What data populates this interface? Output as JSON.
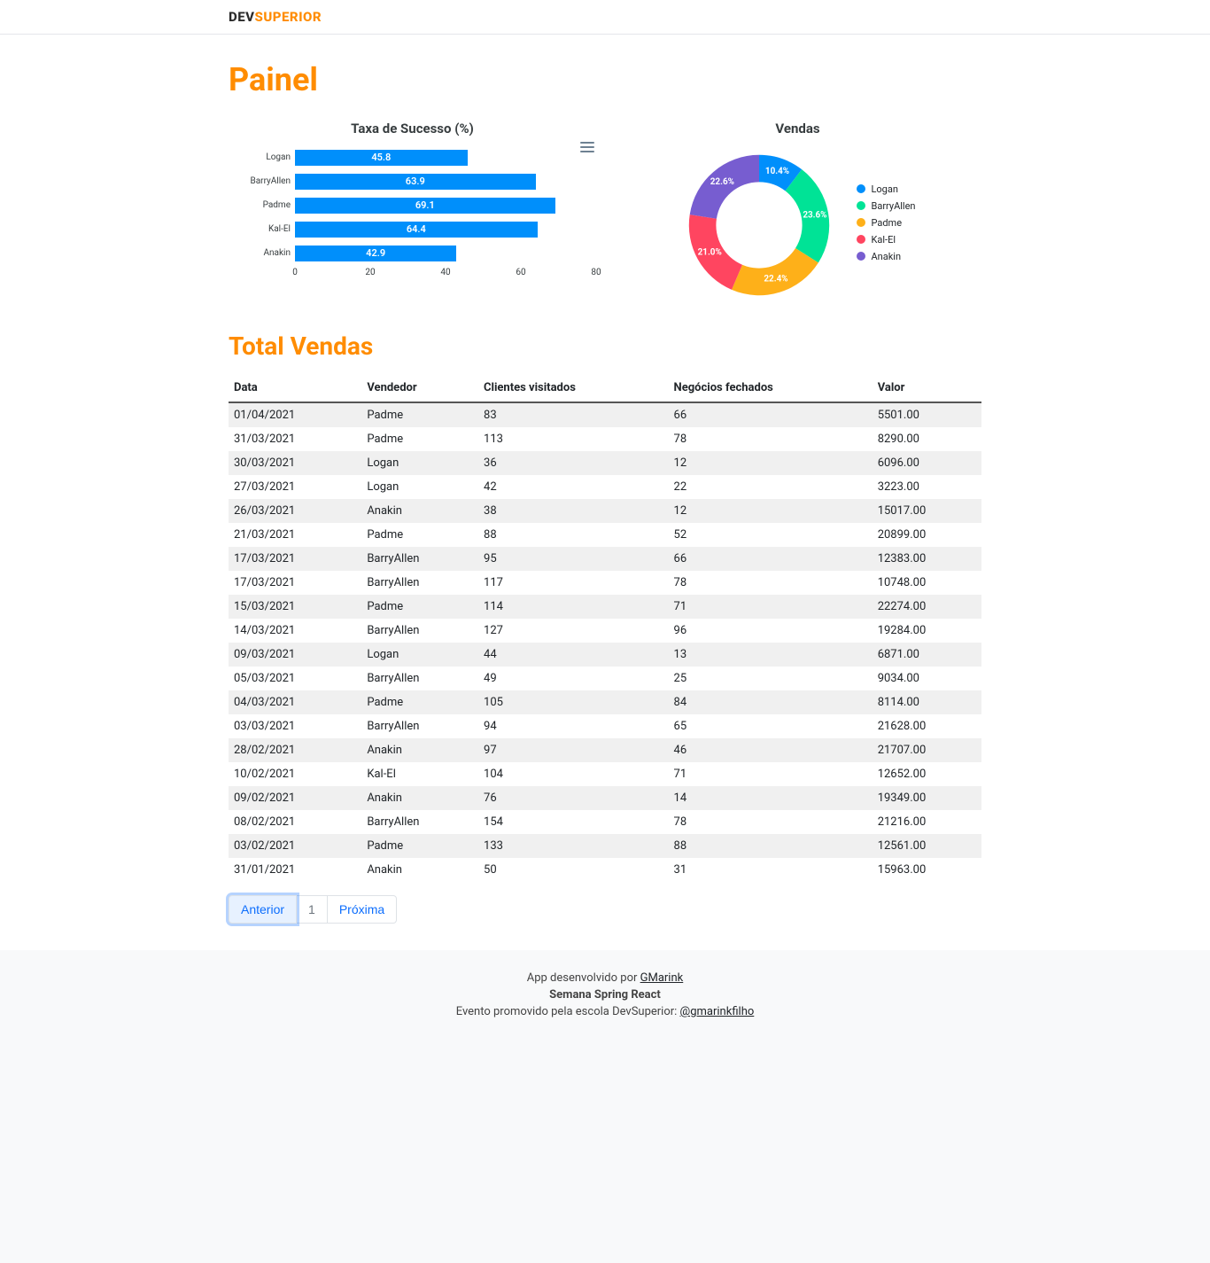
{
  "header": {
    "logo_part1": "DEV",
    "logo_part2": "SUPERIOR"
  },
  "page": {
    "title": "Painel"
  },
  "bar_chart": {
    "title": "Taxa de Sucesso (%)",
    "categories": [
      "Logan",
      "BarryAllen",
      "Padme",
      "Kal-El",
      "Anakin"
    ],
    "values": [
      45.8,
      63.9,
      69.1,
      64.4,
      42.9
    ],
    "xmax": 80,
    "ticks": [
      0,
      20,
      40,
      60,
      80
    ]
  },
  "donut_chart": {
    "title": "Vendas",
    "series": [
      {
        "name": "Logan",
        "value": 10.4,
        "label": "10.4%",
        "color": "#008FFB"
      },
      {
        "name": "BarryAllen",
        "value": 23.6,
        "label": "23.6%",
        "color": "#00E396"
      },
      {
        "name": "Padme",
        "value": 22.4,
        "label": "22.4%",
        "color": "#FEB019"
      },
      {
        "name": "Kal-El",
        "value": 21.0,
        "label": "21.0%",
        "color": "#FF4560"
      },
      {
        "name": "Anakin",
        "value": 22.6,
        "label": "22.6%",
        "color": "#775DD0"
      }
    ]
  },
  "table": {
    "title": "Total Vendas",
    "headers": [
      "Data",
      "Vendedor",
      "Clientes visitados",
      "Negócios fechados",
      "Valor"
    ],
    "rows": [
      [
        "01/04/2021",
        "Padme",
        "83",
        "66",
        "5501.00"
      ],
      [
        "31/03/2021",
        "Padme",
        "113",
        "78",
        "8290.00"
      ],
      [
        "30/03/2021",
        "Logan",
        "36",
        "12",
        "6096.00"
      ],
      [
        "27/03/2021",
        "Logan",
        "42",
        "22",
        "3223.00"
      ],
      [
        "26/03/2021",
        "Anakin",
        "38",
        "12",
        "15017.00"
      ],
      [
        "21/03/2021",
        "Padme",
        "88",
        "52",
        "20899.00"
      ],
      [
        "17/03/2021",
        "BarryAllen",
        "95",
        "66",
        "12383.00"
      ],
      [
        "17/03/2021",
        "BarryAllen",
        "117",
        "78",
        "10748.00"
      ],
      [
        "15/03/2021",
        "Padme",
        "114",
        "71",
        "22274.00"
      ],
      [
        "14/03/2021",
        "BarryAllen",
        "127",
        "96",
        "19284.00"
      ],
      [
        "09/03/2021",
        "Logan",
        "44",
        "13",
        "6871.00"
      ],
      [
        "05/03/2021",
        "BarryAllen",
        "49",
        "25",
        "9034.00"
      ],
      [
        "04/03/2021",
        "Padme",
        "105",
        "84",
        "8114.00"
      ],
      [
        "03/03/2021",
        "BarryAllen",
        "94",
        "65",
        "21628.00"
      ],
      [
        "28/02/2021",
        "Anakin",
        "97",
        "46",
        "21707.00"
      ],
      [
        "10/02/2021",
        "Kal-El",
        "104",
        "71",
        "12652.00"
      ],
      [
        "09/02/2021",
        "Anakin",
        "76",
        "14",
        "19349.00"
      ],
      [
        "08/02/2021",
        "BarryAllen",
        "154",
        "78",
        "21216.00"
      ],
      [
        "03/02/2021",
        "Padme",
        "133",
        "88",
        "12561.00"
      ],
      [
        "31/01/2021",
        "Anakin",
        "50",
        "31",
        "15963.00"
      ]
    ]
  },
  "pagination": {
    "prev": "Anterior",
    "current": "1",
    "next": "Próxima"
  },
  "footer": {
    "line1_prefix": "App desenvolvido por ",
    "line1_link": "GMarink",
    "line2": "Semana Spring React",
    "line3_prefix": "Evento promovido pela escola DevSuperior: ",
    "line3_link": "@gmarinkfilho"
  },
  "chart_data": [
    {
      "type": "bar",
      "orientation": "horizontal",
      "title": "Taxa de Sucesso (%)",
      "categories": [
        "Logan",
        "BarryAllen",
        "Padme",
        "Kal-El",
        "Anakin"
      ],
      "values": [
        45.8,
        63.9,
        69.1,
        64.4,
        42.9
      ],
      "xlabel": "",
      "ylabel": "",
      "xlim": [
        0,
        80
      ],
      "ticks": [
        0,
        20,
        40,
        60,
        80
      ]
    },
    {
      "type": "pie",
      "title": "Vendas",
      "series": [
        {
          "name": "Logan",
          "value": 10.4
        },
        {
          "name": "BarryAllen",
          "value": 23.6
        },
        {
          "name": "Padme",
          "value": 22.4
        },
        {
          "name": "Kal-El",
          "value": 21.0
        },
        {
          "name": "Anakin",
          "value": 22.6
        }
      ],
      "donut": true
    }
  ]
}
